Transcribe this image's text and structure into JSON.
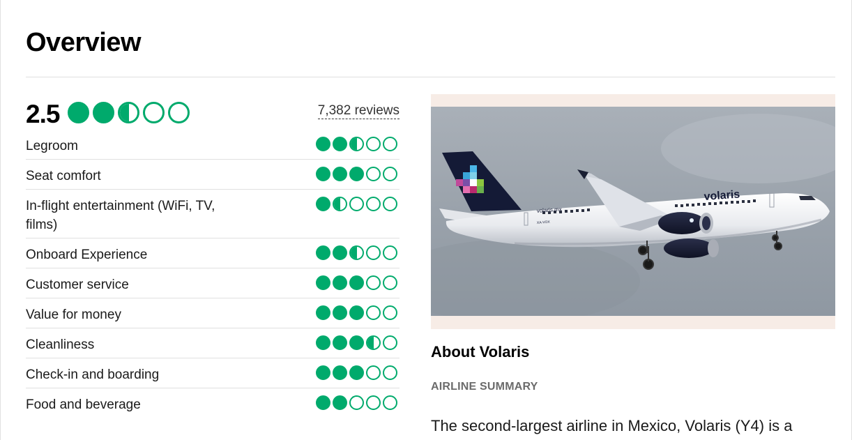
{
  "overview": {
    "title": "Overview",
    "overall_score": "2.5",
    "overall_bubbles": 2.5,
    "review_count": "7,382 reviews"
  },
  "ratings": [
    {
      "label": "Legroom",
      "bubbles": 2.5
    },
    {
      "label": "Seat comfort",
      "bubbles": 3
    },
    {
      "label": "In-flight entertainment (WiFi, TV, films)",
      "bubbles": 1.5
    },
    {
      "label": "Onboard Experience",
      "bubbles": 2.5
    },
    {
      "label": "Customer service",
      "bubbles": 3
    },
    {
      "label": "Value for money",
      "bubbles": 3
    },
    {
      "label": "Cleanliness",
      "bubbles": 3.5
    },
    {
      "label": "Check-in and boarding",
      "bubbles": 3
    },
    {
      "label": "Food and beverage",
      "bubbles": 2
    }
  ],
  "photo": {
    "livery_text": "volaris",
    "livery_small_text": "volaris.mx",
    "registration": "XA-VOX"
  },
  "about": {
    "title": "About Volaris",
    "summary_label": "AIRLINE SUMMARY",
    "summary_text": "The second-largest airline in Mexico, Volaris (Y4) is a"
  },
  "colors": {
    "bubble_green": "#00aa6c",
    "divider": "#e0e0e0",
    "photo_frame": "#f7ece6"
  }
}
